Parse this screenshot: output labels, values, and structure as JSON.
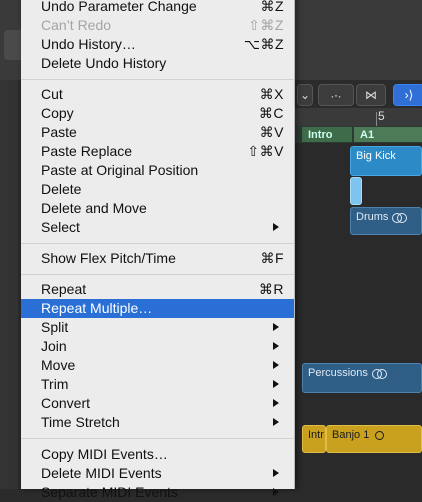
{
  "menu": {
    "group1": [
      {
        "label": "Undo Parameter Change",
        "shortcut": "⌘Z"
      },
      {
        "label": "Can’t Redo",
        "shortcut": "⇧⌘Z"
      },
      {
        "label": "Undo History…",
        "shortcut": "⌥⌘Z"
      },
      {
        "label": "Delete Undo History",
        "shortcut": ""
      }
    ],
    "group2": [
      {
        "label": "Cut",
        "shortcut": "⌘X"
      },
      {
        "label": "Copy",
        "shortcut": "⌘C"
      },
      {
        "label": "Paste",
        "shortcut": "⌘V"
      },
      {
        "label": "Paste Replace",
        "shortcut": "⇧⌘V"
      },
      {
        "label": "Paste at Original Position",
        "shortcut": ""
      },
      {
        "label": "Delete",
        "shortcut": ""
      },
      {
        "label": "Delete and Move",
        "shortcut": ""
      },
      {
        "label": "Select",
        "shortcut": ""
      }
    ],
    "group3": [
      {
        "label": "Show Flex Pitch/Time",
        "shortcut": "⌘F"
      }
    ],
    "group4": [
      {
        "label": "Repeat",
        "shortcut": "⌘R"
      },
      {
        "label": "Repeat Multiple…",
        "shortcut": ""
      },
      {
        "label": "Split",
        "shortcut": ""
      },
      {
        "label": "Join",
        "shortcut": ""
      },
      {
        "label": "Move",
        "shortcut": ""
      },
      {
        "label": "Trim",
        "shortcut": ""
      },
      {
        "label": "Convert",
        "shortcut": ""
      },
      {
        "label": "Time Stretch",
        "shortcut": ""
      }
    ],
    "group5": [
      {
        "label": "Copy MIDI Events…",
        "shortcut": ""
      },
      {
        "label": "Delete MIDI Events",
        "shortcut": ""
      },
      {
        "label": "Separate MIDI Events",
        "shortcut": ""
      }
    ]
  },
  "background": {
    "ruler_bar": "5",
    "markers": {
      "intro": "Intro",
      "a1": "A1"
    },
    "regions": {
      "big_kick": "Big Kick",
      "drums": "Drums",
      "percussions": "Percussions",
      "intro_short": "Intr",
      "banjo": "Banjo 1"
    }
  },
  "colors": {
    "highlight": "#2a6fd6",
    "menu_bg": "#ececec"
  }
}
